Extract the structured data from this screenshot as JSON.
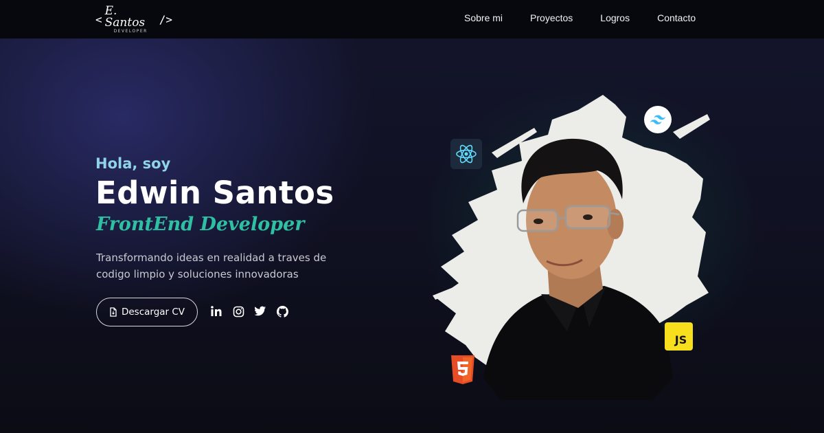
{
  "header": {
    "logo": {
      "left_bracket": "<",
      "name": "E. Santos",
      "subtitle": "DEVELOPER",
      "right_bracket": "/>"
    },
    "nav": [
      "Sobre mi",
      "Proyectos",
      "Logros",
      "Contacto"
    ]
  },
  "hero": {
    "greeting": "Hola, soy",
    "name": "Edwin Santos",
    "role": "FrontEnd Developer",
    "description": "Transformando ideas en realidad a traves de codigo limpio y soluciones innovadoras",
    "cv_button": "Descargar CV",
    "socials": [
      "linkedin-icon",
      "instagram-icon",
      "twitter-icon",
      "github-icon"
    ]
  },
  "visual": {
    "tech_badges": [
      "react-icon",
      "tailwind-icon",
      "js-icon",
      "html5-icon"
    ],
    "js_label": "JS"
  },
  "colors": {
    "greeting": "#8fd3e8",
    "role": "#2fc0a4",
    "header_bg": "#07080d",
    "js_badge": "#f7df1e",
    "html_badge": "#e44d26"
  }
}
